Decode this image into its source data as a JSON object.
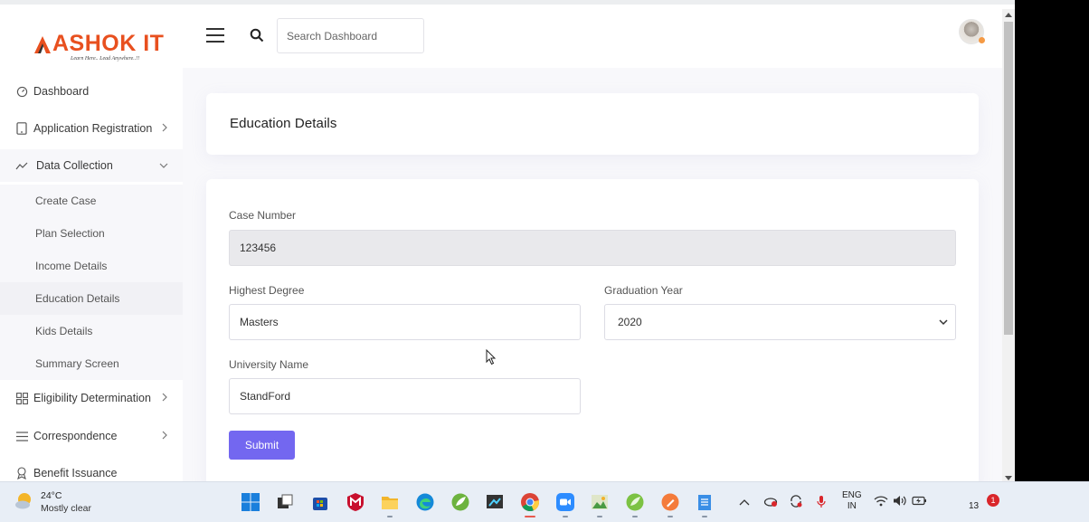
{
  "brand": {
    "name": "ASHOK IT",
    "tagline": "Learn Here.. Lead Anywhere..!!"
  },
  "header": {
    "search_placeholder": "Search Dashboard"
  },
  "sidebar": {
    "items": [
      {
        "label": "Dashboard",
        "icon": "gauge-icon"
      },
      {
        "label": "Application Registration",
        "icon": "tablet-icon",
        "has_children": true
      },
      {
        "label": "Data Collection",
        "icon": "trend-icon",
        "expanded": true
      },
      {
        "label": "Eligibility Determination",
        "icon": "grid-icon",
        "has_children": true
      },
      {
        "label": "Correspondence",
        "icon": "menu-lines-icon",
        "has_children": true
      },
      {
        "label": "Benefit Issuance",
        "icon": "award-icon"
      }
    ],
    "data_collection_children": [
      {
        "label": "Create Case"
      },
      {
        "label": "Plan Selection"
      },
      {
        "label": "Income Details"
      },
      {
        "label": "Education Details",
        "active": true
      },
      {
        "label": "Kids Details"
      },
      {
        "label": "Summary Screen"
      }
    ]
  },
  "page": {
    "title": "Education Details"
  },
  "form": {
    "case_number": {
      "label": "Case Number",
      "value": "123456"
    },
    "highest_degree": {
      "label": "Highest Degree",
      "value": "Masters"
    },
    "graduation_year": {
      "label": "Graduation Year",
      "value": "2020"
    },
    "university_name": {
      "label": "University Name",
      "value": "StandFord"
    },
    "submit_label": "Submit"
  },
  "colors": {
    "accent": "#7367f0",
    "brand": "#e8501f"
  },
  "taskbar": {
    "weather": {
      "temp": "24°C",
      "desc": "Mostly clear"
    },
    "language": {
      "line1": "ENG",
      "line2": "IN"
    },
    "clock": "13",
    "notifications": "1"
  }
}
